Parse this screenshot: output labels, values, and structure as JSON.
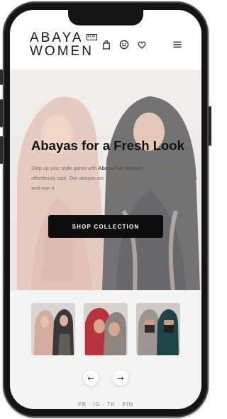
{
  "brand": {
    "line1": "ABAYA",
    "badge": "FOR",
    "line2": "WOMEN"
  },
  "header": {
    "icons": [
      "shopping-bag-icon",
      "account-icon",
      "heart-icon",
      "menu-icon"
    ]
  },
  "hero": {
    "title": "Abayas for a Fresh Look",
    "text_before": "Step up your style game with ",
    "text_bold": "Abaya For Women",
    "text_after": " — trendy, comfy, and effortlessly cool. Our abayas are made for every vibe. Find your perfect fit and own it.",
    "cta_label": "SHOP COLLECTION"
  },
  "carousel": {
    "prev_icon": "arrow-left-icon",
    "next_icon": "arrow-right-icon",
    "prev_glyph": "←",
    "next_glyph": "→"
  },
  "social": {
    "items": [
      "FB",
      "IG",
      "TK",
      "PIN"
    ],
    "separator": "·"
  },
  "colors": {
    "black": "#0d0d0d",
    "background": "#f4f4f4",
    "hero_bg": "#e7e4e1"
  }
}
